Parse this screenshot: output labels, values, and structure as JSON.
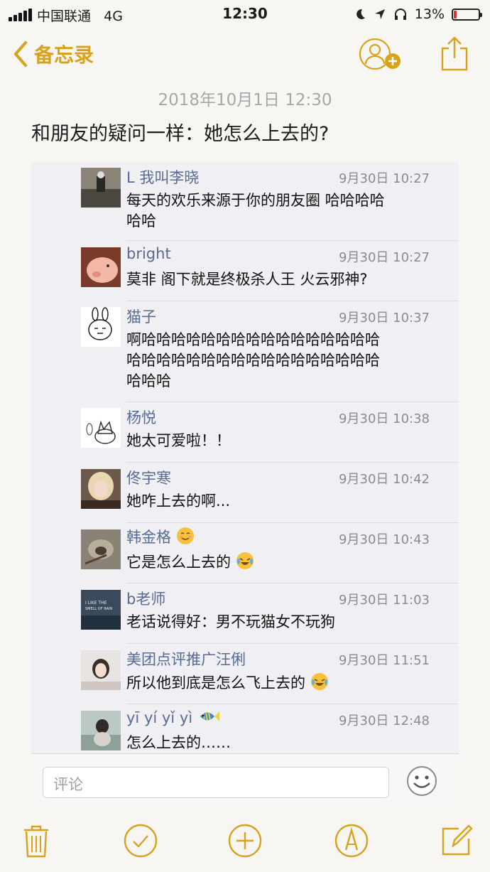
{
  "status_bar": {
    "carrier": "中国联通",
    "network": "4G",
    "time": "12:30",
    "battery_percent": "13%",
    "battery_level": 0.13
  },
  "nav": {
    "back_label": "备忘录"
  },
  "note": {
    "date": "2018年10月1日 12:30",
    "headline": "和朋友的疑问一样：她怎么上去的?"
  },
  "comments": [
    {
      "name": "L 我叫李晓",
      "time": "9月30日 10:27",
      "lines": [
        "每天的欢乐来源于你的朋友圈 哈哈哈哈",
        "哈哈"
      ]
    },
    {
      "name": "bright",
      "time": "9月30日 10:27",
      "lines": [
        "莫非 阁下就是终极杀人王 火云邪神?"
      ]
    },
    {
      "name": "猫子",
      "time": "9月30日 10:37",
      "lines": [
        "啊哈哈哈哈哈哈哈哈哈哈哈哈哈哈哈哈",
        "哈哈哈哈哈哈哈哈哈哈哈哈哈哈哈哈哈",
        "哈哈哈"
      ]
    },
    {
      "name": "杨悦",
      "time": "9月30日 10:38",
      "lines": [
        "她太可爱啦！！"
      ]
    },
    {
      "name": "佟宇寒",
      "time": "9月30日 10:42",
      "lines": [
        "她咋上去的啊..."
      ]
    },
    {
      "name": "韩金格",
      "time": "9月30日 10:43",
      "lines": [
        "它是怎么上去的"
      ]
    },
    {
      "name": "b老师",
      "time": "9月30日 11:03",
      "lines": [
        "老话说得好：男不玩猫女不玩狗"
      ]
    },
    {
      "name": "美团点评推广汪俐",
      "time": "9月30日 11:51",
      "lines": [
        "所以他到底是怎么飞上去的"
      ]
    },
    {
      "name": "yī yí yǐ yì",
      "time": "9月30日 12:48",
      "lines": [
        "怎么上去的……"
      ]
    }
  ],
  "avatar_texts": {
    "b_teacher": "I LIKE THE",
    "b_teacher_2": "SMELL OF RAIN"
  },
  "comment_input": {
    "placeholder": "评论"
  },
  "icons": {
    "back": "chevron-left-icon",
    "add_person": "add-person-icon",
    "share": "share-icon",
    "emoji": "emoji-icon",
    "trash": "trash-icon",
    "checklist": "checklist-icon",
    "add": "plus-icon",
    "markup": "pen-icon",
    "compose": "compose-icon"
  },
  "colors": {
    "accent": "#d9a21d",
    "name": "#576b95",
    "battery_low": "#e0302a"
  }
}
